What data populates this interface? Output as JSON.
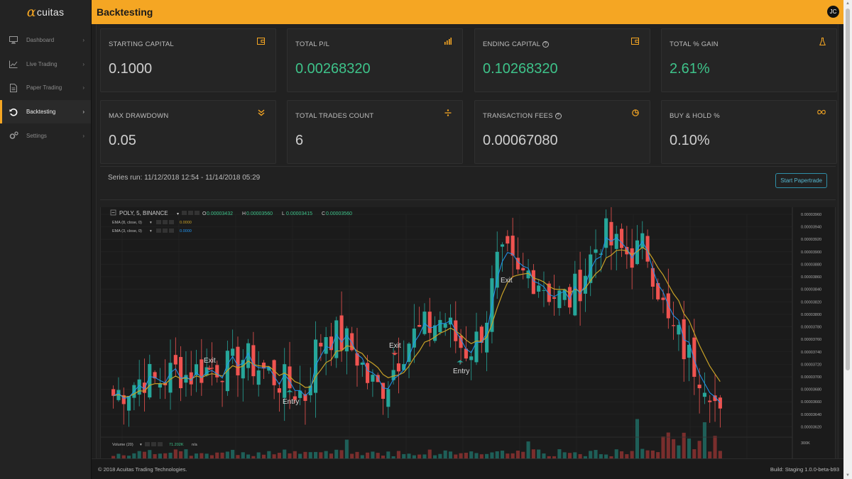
{
  "app": {
    "logo_alpha": "α",
    "logo_rest": "cuitas",
    "accent": "#f5a623"
  },
  "header": {
    "title": "Backtesting",
    "avatar": "JC"
  },
  "sidebar": {
    "items": [
      {
        "label": "Dashboard",
        "icon": "monitor-icon"
      },
      {
        "label": "Live Trading",
        "icon": "chart-line-icon"
      },
      {
        "label": "Paper Trading",
        "icon": "document-icon"
      },
      {
        "label": "Backtesting",
        "icon": "history-icon",
        "active": true
      },
      {
        "label": "Settings",
        "icon": "gears-icon"
      }
    ]
  },
  "cards": [
    {
      "label": "STARTING CAPITAL",
      "value": "0.1000",
      "icon": "wallet-icon"
    },
    {
      "label": "TOTAL P/L",
      "value": "0.00268320",
      "icon": "bars-icon",
      "green": true
    },
    {
      "label": "ENDING CAPITAL",
      "value": "0.10268320",
      "icon": "wallet-icon",
      "green": true,
      "help": true
    },
    {
      "label": "TOTAL % GAIN",
      "value": "2.61%",
      "icon": "flask-icon",
      "green": true
    },
    {
      "label": "MAX DRAWDOWN",
      "value": "0.05",
      "icon": "double-chevron-down-icon"
    },
    {
      "label": "TOTAL TRADES COUNT",
      "value": "6",
      "icon": "divide-icon"
    },
    {
      "label": "TRANSACTION FEES",
      "value": "0.00067080",
      "icon": "pie-icon",
      "help": true
    },
    {
      "label": "BUY & HOLD %",
      "value": "0.10%",
      "icon": "infinity-icon"
    }
  ],
  "series": {
    "label": "Series run: 11/12/2018 12:54 - 11/14/2018 05:29",
    "button": "Start Papertrade"
  },
  "chart": {
    "symbol_line": "POLY, 5, BINANCE",
    "o_label": "O",
    "o_value": "0.00003432",
    "h_label": "H",
    "h_value": "0.00003560",
    "l_label": "L",
    "l_value": "0.00003415",
    "c_label": "C",
    "c_value": "0.00003560",
    "ema1_label": "EMA (8, close, 0)",
    "ema1_value": "0.0000",
    "ema2_label": "EMA (3, close, 0)",
    "ema2_value": "0.0000",
    "volume_label": "Volume (20)",
    "volume_value": "71.202K",
    "volume_na": "n/a",
    "price_ticks": [
      "0.00003960",
      "0.00003940",
      "0.00003920",
      "0.00003900",
      "0.00003880",
      "0.00003860",
      "0.00003840",
      "0.00003820",
      "0.00003800",
      "0.00003780",
      "0.00003760",
      "0.00003740",
      "0.00003720",
      "0.00003700",
      "0.00003680",
      "0.00003660",
      "0.00003640",
      "0.00003620"
    ],
    "volume_ticks": [
      "300K",
      "200K",
      "100K"
    ],
    "annotations": [
      {
        "text": "Exit"
      },
      {
        "text": "Entry"
      },
      {
        "text": "Exit"
      },
      {
        "text": "Entry"
      },
      {
        "text": "Exit"
      }
    ],
    "colors": {
      "up": "#26a69a",
      "down": "#ef5350",
      "ema_fast": "#2196f3",
      "ema_slow": "#c9a227"
    }
  },
  "chart_data": {
    "type": "candlestick",
    "title": "POLY, 5, BINANCE",
    "ylim": [
      3.62e-05,
      3.96e-05
    ],
    "closes": [
      3.68e-05,
      3.69e-05,
      3.7e-05,
      3.71e-05,
      3.7e-05,
      3.71e-05,
      3.72e-05,
      3.71e-05,
      3.72e-05,
      3.72e-05,
      3.73e-05,
      3.72e-05,
      3.74e-05,
      3.73e-05,
      3.72e-05,
      3.71e-05,
      3.7e-05,
      3.69e-05,
      3.68e-05,
      3.75e-05,
      3.78e-05,
      3.77e-05,
      3.76e-05,
      3.74e-05,
      3.7e-05,
      3.69e-05,
      3.71e-05,
      3.75e-05,
      3.77e-05,
      3.78e-05,
      3.79e-05,
      3.8e-05,
      3.77e-05,
      3.75e-05,
      3.76e-05,
      3.8e-05,
      3.88e-05,
      3.89e-05,
      3.86e-05,
      3.87e-05,
      3.86e-05,
      3.84e-05,
      3.83e-05,
      3.83e-05,
      3.86e-05,
      3.9e-05,
      3.93e-05,
      3.91e-05,
      3.9e-05,
      3.9e-05,
      3.91e-05,
      3.86e-05,
      3.79e-05,
      3.77e-05,
      3.74e-05,
      3.72e-05,
      3.7e-05,
      3.64e-05
    ]
  },
  "footer": {
    "copyright": "© 2018 Acuitas Trading Technologies.",
    "build": "Build: Staging 1.0.0-beta-b93"
  }
}
